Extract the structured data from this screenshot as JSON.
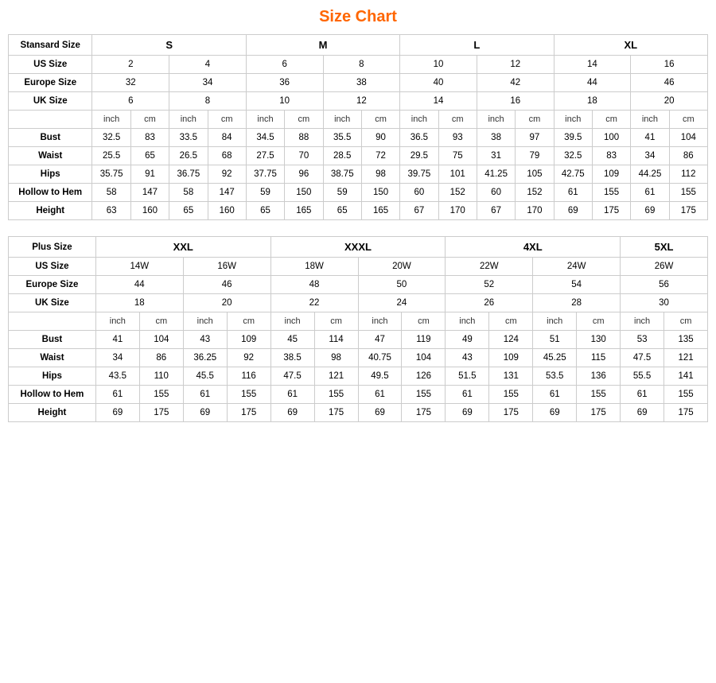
{
  "title": "Size Chart",
  "standard": {
    "label": "Stansard Size",
    "groups": [
      "S",
      "M",
      "L",
      "XL"
    ],
    "us_size_label": "US Size",
    "us_sizes": [
      "2",
      "4",
      "6",
      "8",
      "10",
      "12",
      "14",
      "16"
    ],
    "europe_size_label": "Europe Size",
    "europe_sizes": [
      "32",
      "34",
      "36",
      "38",
      "40",
      "42",
      "44",
      "46"
    ],
    "uk_size_label": "UK Size",
    "uk_sizes": [
      "6",
      "8",
      "10",
      "12",
      "14",
      "16",
      "18",
      "20"
    ],
    "unit_inch": "inch",
    "unit_cm": "cm",
    "rows": [
      {
        "label": "Bust",
        "values": [
          "32.5",
          "83",
          "33.5",
          "84",
          "34.5",
          "88",
          "35.5",
          "90",
          "36.5",
          "93",
          "38",
          "97",
          "39.5",
          "100",
          "41",
          "104"
        ]
      },
      {
        "label": "Waist",
        "values": [
          "25.5",
          "65",
          "26.5",
          "68",
          "27.5",
          "70",
          "28.5",
          "72",
          "29.5",
          "75",
          "31",
          "79",
          "32.5",
          "83",
          "34",
          "86"
        ]
      },
      {
        "label": "Hips",
        "values": [
          "35.75",
          "91",
          "36.75",
          "92",
          "37.75",
          "96",
          "38.75",
          "98",
          "39.75",
          "101",
          "41.25",
          "105",
          "42.75",
          "109",
          "44.25",
          "112"
        ]
      },
      {
        "label": "Hollow to Hem",
        "values": [
          "58",
          "147",
          "58",
          "147",
          "59",
          "150",
          "59",
          "150",
          "60",
          "152",
          "60",
          "152",
          "61",
          "155",
          "61",
          "155"
        ]
      },
      {
        "label": "Height",
        "values": [
          "63",
          "160",
          "65",
          "160",
          "65",
          "165",
          "65",
          "165",
          "67",
          "170",
          "67",
          "170",
          "69",
          "175",
          "69",
          "175"
        ]
      }
    ]
  },
  "plus": {
    "label": "Plus Size",
    "groups": [
      "XXL",
      "XXXL",
      "4XL",
      "5XL"
    ],
    "us_size_label": "US Size",
    "us_sizes": [
      "14W",
      "16W",
      "18W",
      "20W",
      "22W",
      "24W",
      "26W"
    ],
    "europe_size_label": "Europe Size",
    "europe_sizes": [
      "44",
      "46",
      "48",
      "50",
      "52",
      "54",
      "56"
    ],
    "uk_size_label": "UK Size",
    "uk_sizes": [
      "18",
      "20",
      "22",
      "24",
      "26",
      "28",
      "30"
    ],
    "unit_inch": "inch",
    "unit_cm": "cm",
    "rows": [
      {
        "label": "Bust",
        "values": [
          "41",
          "104",
          "43",
          "109",
          "45",
          "114",
          "47",
          "119",
          "49",
          "124",
          "51",
          "130",
          "53",
          "135"
        ]
      },
      {
        "label": "Waist",
        "values": [
          "34",
          "86",
          "36.25",
          "92",
          "38.5",
          "98",
          "40.75",
          "104",
          "43",
          "109",
          "45.25",
          "115",
          "47.5",
          "121"
        ]
      },
      {
        "label": "Hips",
        "values": [
          "43.5",
          "110",
          "45.5",
          "116",
          "47.5",
          "121",
          "49.5",
          "126",
          "51.5",
          "131",
          "53.5",
          "136",
          "55.5",
          "141"
        ]
      },
      {
        "label": "Hollow to Hem",
        "values": [
          "61",
          "155",
          "61",
          "155",
          "61",
          "155",
          "61",
          "155",
          "61",
          "155",
          "61",
          "155",
          "61",
          "155"
        ]
      },
      {
        "label": "Height",
        "values": [
          "69",
          "175",
          "69",
          "175",
          "69",
          "175",
          "69",
          "175",
          "69",
          "175",
          "69",
          "175",
          "69",
          "175"
        ]
      }
    ]
  }
}
